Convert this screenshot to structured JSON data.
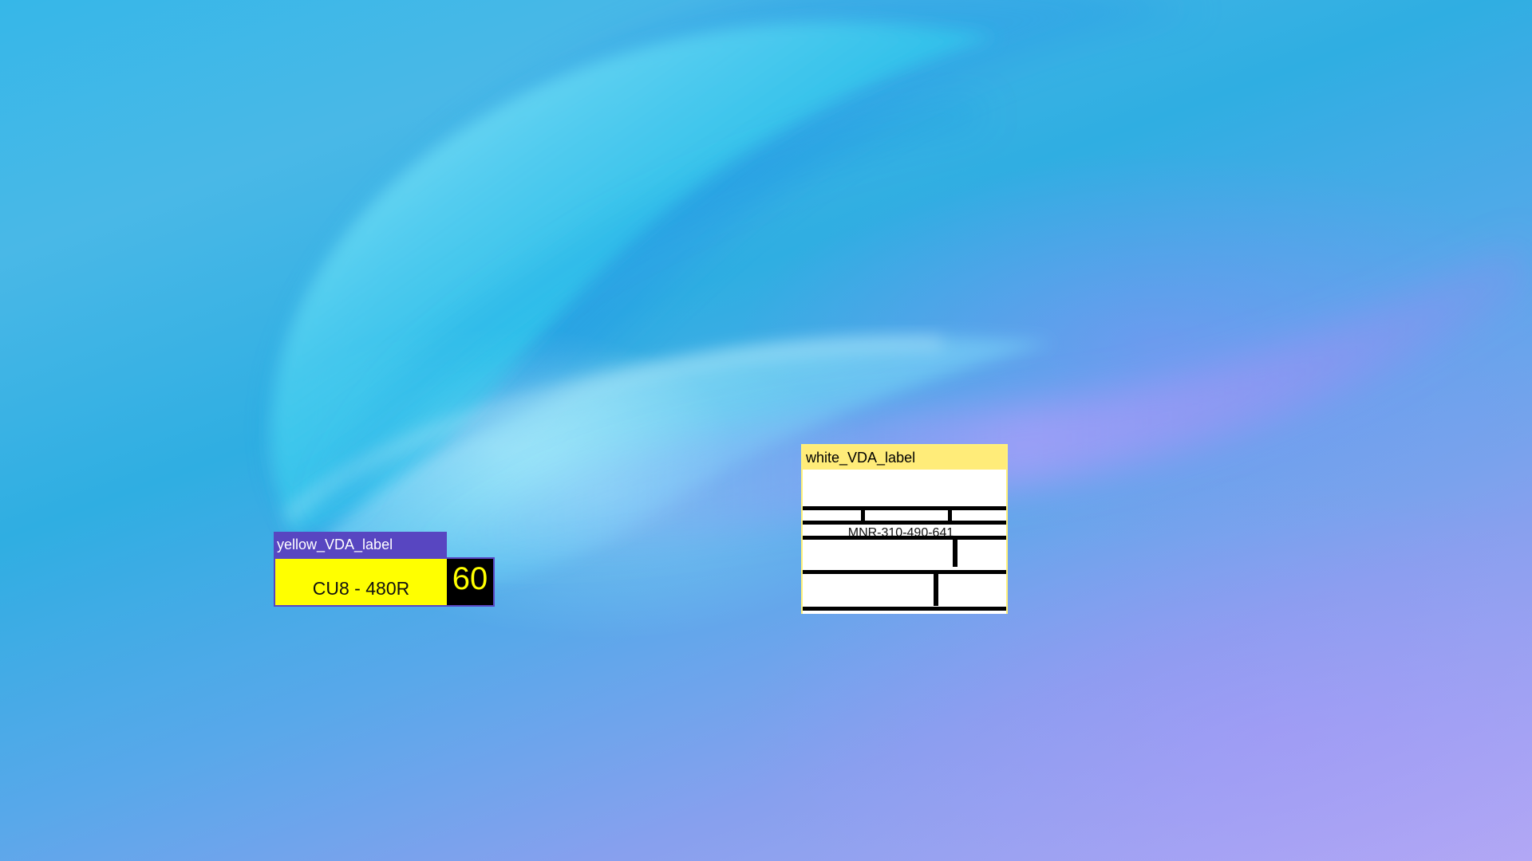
{
  "desktop": {
    "windows": {
      "yellow": {
        "title": "yellow_VDA_label",
        "code": "CU8 - 480R",
        "number": "60",
        "colors": {
          "title_bar": "#5846c1",
          "label_background": "#ffff00",
          "number_background": "#000000",
          "number_text": "#ffff00"
        }
      },
      "white": {
        "title": "white_VDA_label",
        "part_number": "MNR-310-490-641",
        "colors": {
          "title_bar": "#ffec79",
          "label_background": "#ffffff",
          "lines": "#000000"
        }
      }
    }
  }
}
